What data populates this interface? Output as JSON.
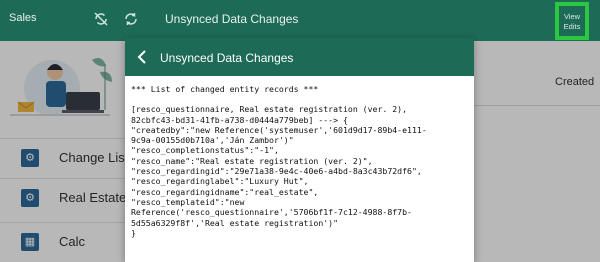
{
  "app": {
    "title": "Sales",
    "bar_title": "Unsynced Data Changes",
    "view_edits_label_1": "View",
    "view_edits_label_2": "Edits",
    "accent_color": "#1d6a57",
    "highlight_color": "#2bc740"
  },
  "background": {
    "column_header": "Created",
    "side_items": [
      {
        "label": "Change List",
        "icon": "gear-icon"
      },
      {
        "label": "Real Estates",
        "icon": "gear-icon"
      },
      {
        "label": "Calc",
        "icon": "calculator-icon"
      }
    ]
  },
  "modal": {
    "title": "Unsynced Data Changes",
    "lines": [
      "*** List of changed entity records ***",
      "",
      "[resco_questionnaire, Real estate registration (ver. 2),",
      "82cbfc43-bd31-41fb-a738-d0444a779beb] ---> {",
      "\"createdby\":\"new Reference('systemuser','601d9d17-89b4-e111-",
      "9c9a-00155d0b710a','Ján Zambor')\"",
      "\"resco_completionstatus\":\"-1\",",
      "\"resco_name\":\"Real estate registration (ver. 2)\",",
      "\"resco_regardingid\":\"29e71a38-9e4c-40e6-a4bd-8a3c43b72df6\",",
      "\"resco_regardinglabel\":\"Luxury Hut\",",
      "\"resco_regardingidname\":\"real_estate\",",
      "\"resco_templateid\":\"new",
      "Reference('resco_questionnaire','5706bf1f-7c12-4988-8f7b-",
      "5d55a6329f8f','Real estate registration')\"",
      "}"
    ]
  }
}
